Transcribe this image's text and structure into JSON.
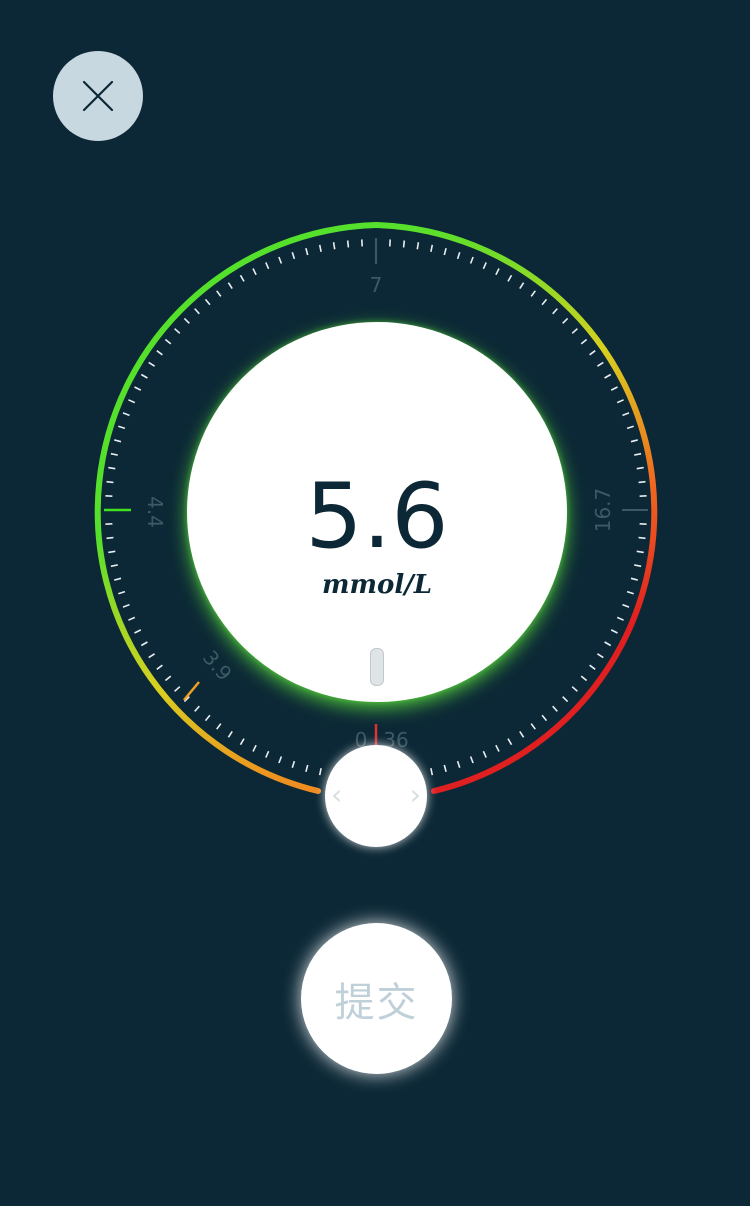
{
  "close_button": {
    "icon": "close-icon"
  },
  "dial": {
    "value": "5.6",
    "unit": "mmol/L",
    "scale_labels": {
      "top": "7",
      "left": "4.4",
      "right": "16.7",
      "lower_left": "3.9",
      "bottom_left": "0",
      "bottom_right": "36"
    },
    "arc_colors": {
      "green": "#55e02c",
      "yellow": "#d8d020",
      "orange": "#f08a20",
      "red": "#e02020"
    },
    "marker_colors": {
      "left": "#40e020",
      "lower_left": "#f0a020",
      "bottom": "#e03030"
    }
  },
  "knob": {
    "left_arrow": "‹",
    "right_arrow": "›"
  },
  "submit_button": {
    "label": "提交"
  },
  "colors": {
    "background": "#0c2836",
    "accent_text": "#0c2836"
  }
}
